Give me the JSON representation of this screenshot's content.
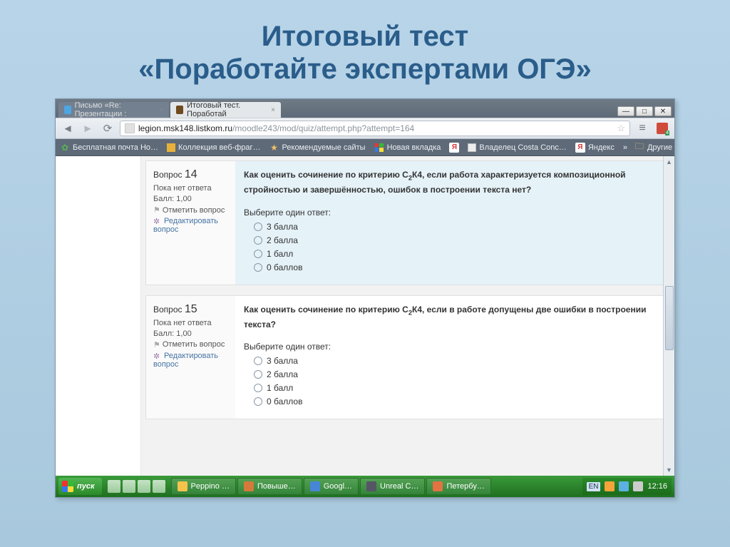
{
  "slide": {
    "title_line1": "Итоговый тест",
    "title_line2": "«Поработайте экспертами ОГЭ»"
  },
  "browser": {
    "tabs": [
      {
        "label": "Письмо «Re: Презентации :",
        "active": false
      },
      {
        "label": "Итоговый тест. Поработай",
        "active": true
      }
    ],
    "url_host": "legion.msk148.listkom.ru",
    "url_path": "/moodle243/mod/quiz/attempt.php?attempt=164",
    "bookmarks": [
      "Бесплатная почта Но…",
      "Коллекция веб-фраг…",
      "Рекомендуемые сайты",
      "Новая вкладка",
      "Я",
      "Владелец Costa Conc…",
      "Яндекс"
    ],
    "bookmarks_more": "»",
    "bookmarks_other": "Другие закладки"
  },
  "quiz": {
    "questions": [
      {
        "num": "14",
        "state": "Пока нет ответа",
        "score_label": "Балл: 1,00",
        "flag_label": "Отметить вопрос",
        "edit_label": "Редактировать вопрос",
        "text_before": "Как оценить сочинение по критерию С",
        "text_sub": "2",
        "text_mid": "К4, если работа  характеризуется композиционной  стройностью и завершённостью, ошибок в построении текста нет?",
        "prompt": "Выберите один ответ:",
        "options": [
          "3 балла",
          "2 балла",
          "1 балл",
          "0 баллов"
        ],
        "highlight": true
      },
      {
        "num": "15",
        "state": "Пока нет ответа",
        "score_label": "Балл: 1,00",
        "flag_label": "Отметить вопрос",
        "edit_label": "Редактировать вопрос",
        "text_before": "Как оценить сочинение по критерию С",
        "text_sub": "2",
        "text_mid": "К4, если в работе допущены две ошибки в построении текста?",
        "prompt": "Выберите один ответ:",
        "options": [
          "3 балла",
          "2 балла",
          "1 балл",
          "0 баллов"
        ],
        "highlight": false
      }
    ],
    "question_word": "Вопрос"
  },
  "taskbar": {
    "start": "пуск",
    "buttons": [
      {
        "label": "Peppino …",
        "color": "#f5c24b"
      },
      {
        "label": "Повыше…",
        "color": "#d57a3a"
      },
      {
        "label": "Googl…",
        "color": "#4785d6"
      },
      {
        "label": "Unreal C…",
        "color": "#556"
      },
      {
        "label": "Петербу…",
        "color": "#e27241"
      }
    ],
    "lang": "EN",
    "clock": "12:16"
  },
  "colors": {
    "title": "#2a5d8a",
    "taskbar": "#2b8a2b"
  }
}
